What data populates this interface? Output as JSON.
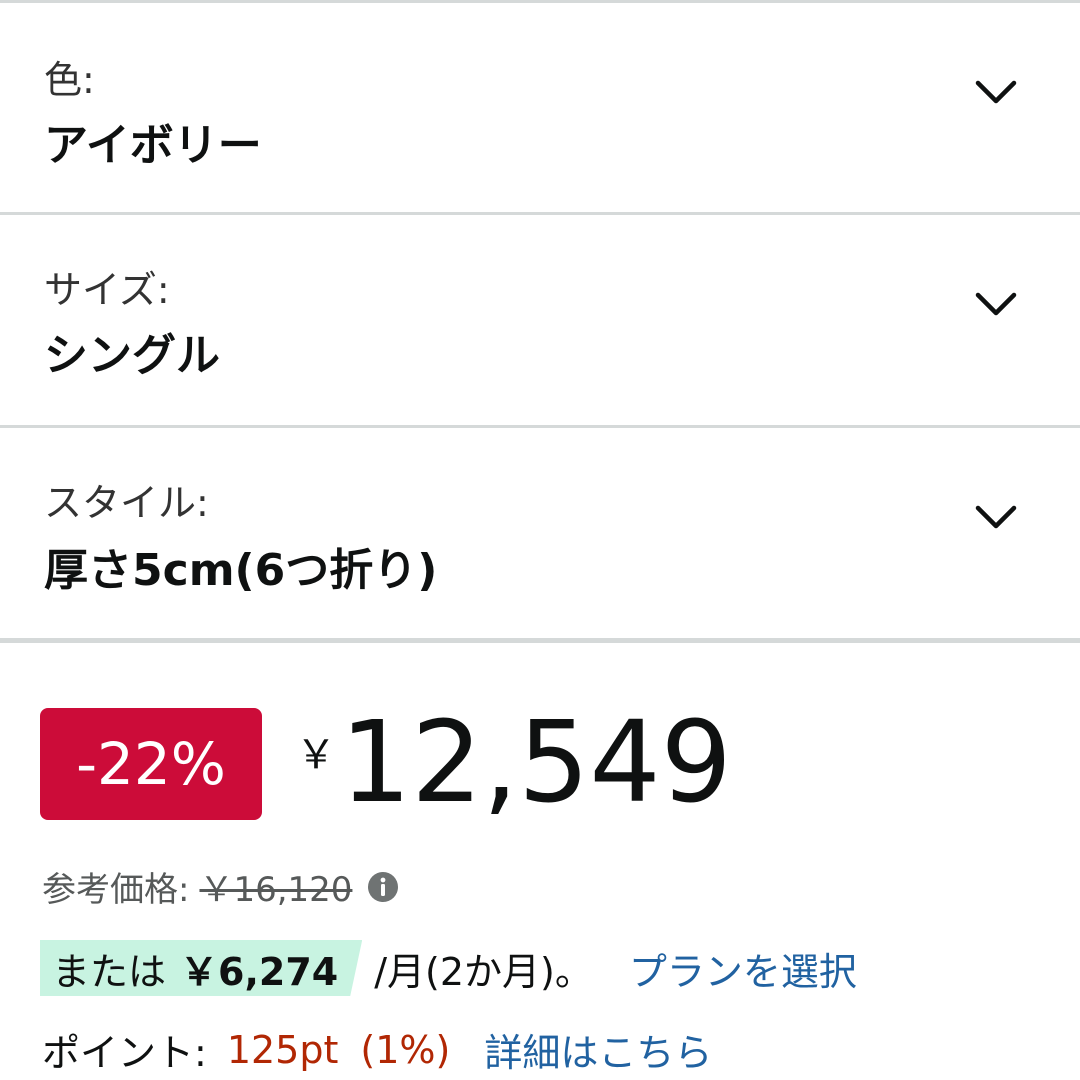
{
  "variants": [
    {
      "label": "色:",
      "value": "アイボリー",
      "icon": "chevron-down-icon"
    },
    {
      "label": "サイズ:",
      "value": "シングル",
      "icon": "chevron-down-icon"
    },
    {
      "label": "スタイル:",
      "value": "厚さ5cm(6つ折り)",
      "icon": "chevron-down-icon"
    }
  ],
  "price": {
    "discount_badge": "-22%",
    "currency": "￥",
    "amount": "12,549",
    "reference_label": "参考価格:",
    "reference_price": "￥16,120",
    "info_icon": "info-icon"
  },
  "installment": {
    "prefix": "または",
    "amount": "￥6,274",
    "suffix": "/月(2か月)。",
    "link": "プランを選択"
  },
  "points": {
    "label": "ポイント:",
    "value": "125pt",
    "percent": "(1%)",
    "link": "詳細はこちら"
  },
  "colors": {
    "discount": "#cc0c39",
    "highlight": "#c8f3e1",
    "link": "#2162a1",
    "points": "#b12704",
    "divider": "#d5d9d9"
  }
}
